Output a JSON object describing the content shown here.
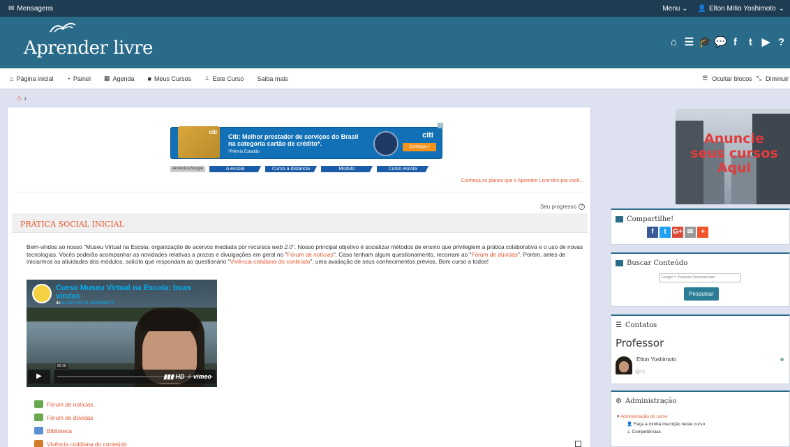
{
  "topbar": {
    "messages": "Mensagens",
    "menu": "Menu",
    "user": "Elton Mitio Yoshimoto"
  },
  "logo": {
    "text": "Aprender livre"
  },
  "header_icons": [
    "home-icon",
    "list-icon",
    "graduation-icon",
    "chat-icon",
    "facebook-icon",
    "twitter-icon",
    "youtube-icon",
    "help-icon"
  ],
  "nav": {
    "items": [
      "Página inicial",
      "Painel",
      "Agenda",
      "Meus Cursos",
      "Este Curso",
      "Saiba mais"
    ],
    "hide_blocks": "Ocultar blocos",
    "shrink": "Diminuir"
  },
  "breadcrumb": {
    "sep": "›"
  },
  "ad_banner": {
    "headline": "Citi: Melhor prestador de serviços do Brasil na categoria cartão de crédito*.",
    "note": "*Prêmio Estadão",
    "brand": "citi",
    "cta": "Conheça »",
    "card_brand": "citi"
  },
  "ad_links": {
    "google": "AnúnciosGoogle",
    "tabs": [
      "A escola",
      "Curso a distancia",
      "Modulo",
      "Curso escola"
    ]
  },
  "plans_link": "Conheça os planos que o Aprender Livre têm pra você...",
  "progress": "Seu progresso",
  "section": {
    "title": "PRÁTICA SOCIAL INICIAL"
  },
  "intro": {
    "p1": "Bem-vindos ao nosso \"Museu Virtual na Escola: organização de acervos mediada por recursos ",
    "p1em": "web 2.0",
    "p2": "\". Nosso principal objetivo é socializar métodos de ensino que privilegiem a prática colaborativa e o uso de novas tecnologias. Vocês poderão acompanhar as novidades relativas a prazos e divulgações em geral no \"",
    "link1": "Fórum de notícias",
    "p3": "\". Caso tenham algum questionamento, recorram ao \"",
    "link2": "Fórum de dúvidas",
    "p4": "\". Porém, antes de iniciarmos as atividades dos módulos, solicito que respondam ao questionário \"",
    "link3": "Vivência cotidiana do conteúdo",
    "p5": "\", uma avaliação de seus conhecimentos prévios. Bom curso a todos!"
  },
  "video": {
    "title": "Curso Museu Virtual na Escola: boas vindas",
    "by": "de",
    "author": "ELTON MITIO YOSHIMOTO",
    "time": "00:19",
    "hd": "HD",
    "brand": "vimeo"
  },
  "activities": [
    {
      "label": "Fórum de notícias",
      "icon": "forum-icon"
    },
    {
      "label": "Fórum de dúvidas",
      "icon": "forum-icon"
    },
    {
      "label": "Biblioteca",
      "icon": "folder-icon"
    },
    {
      "label": "Vivência cotidiana do conteúdo",
      "icon": "quiz-icon"
    }
  ],
  "ad_right": {
    "line1": "Anuncie",
    "line2": "seus cursos",
    "line3": "Aqui"
  },
  "share": {
    "title": "Compartilhe!",
    "icons": [
      "f",
      "t",
      "G+",
      "✉",
      "+"
    ]
  },
  "search": {
    "title": "Buscar Conteúdo",
    "placeholder": "Google™ Pesquisa Personalizada",
    "button": "Pesquisar"
  },
  "contacts": {
    "title": "Contatos",
    "role": "Professor",
    "name": "Elton Yoshimoto"
  },
  "admin": {
    "title": "Administração",
    "course_admin": "Administração do curso",
    "enrol": "Faça a minha inscrição neste curso",
    "competencies": "Competências"
  }
}
